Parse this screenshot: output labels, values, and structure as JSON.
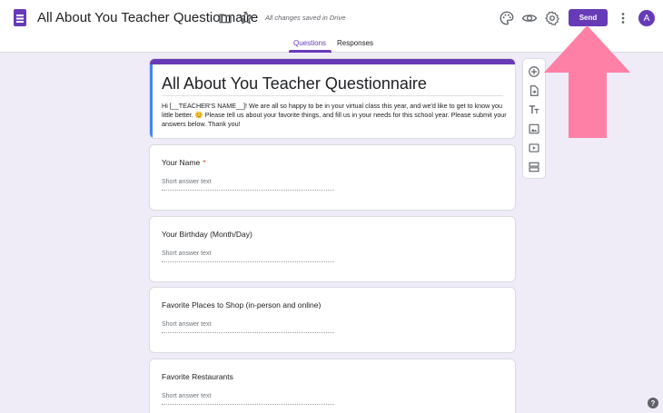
{
  "header": {
    "doc_title": "All About You Teacher Questionnaire",
    "saved_status": "All changes saved in Drive",
    "send_label": "Send",
    "avatar_letter": "A",
    "icons": [
      "forms-doc-icon",
      "folder-icon",
      "star-icon",
      "palette-icon",
      "eye-icon",
      "gear-icon",
      "more-vert-icon"
    ]
  },
  "tabs": {
    "questions": "Questions",
    "responses": "Responses",
    "active": "questions"
  },
  "form": {
    "title": "All About You Teacher Questionnaire",
    "description": "Hi [__TEACHER'S NAME__]! We are all so happy to be in your virtual class this year, and we'd like to get to know you little better. 😊 Please tell us about your favorite things, and fill us in your needs for this school year. Please submit your answers below. Thank you!"
  },
  "questions": [
    {
      "title": "Your Name",
      "required_mark": "*",
      "placeholder": "Short answer text"
    },
    {
      "title": "Your Birthday (Month/Day)",
      "placeholder": "Short answer text"
    },
    {
      "title": "Favorite Places to Shop (in-person and online)",
      "placeholder": "Short answer text"
    },
    {
      "title": "Favorite Restaurants",
      "placeholder": "Short answer text"
    }
  ],
  "toolbar": {
    "icons": [
      "add-question-icon",
      "import-questions-icon",
      "add-title-icon",
      "add-image-icon",
      "add-video-icon",
      "add-section-icon"
    ]
  },
  "colors": {
    "accent": "#673ab7",
    "background": "#efebf7",
    "annotation_arrow": "#ff80a6"
  },
  "help_label": "?"
}
